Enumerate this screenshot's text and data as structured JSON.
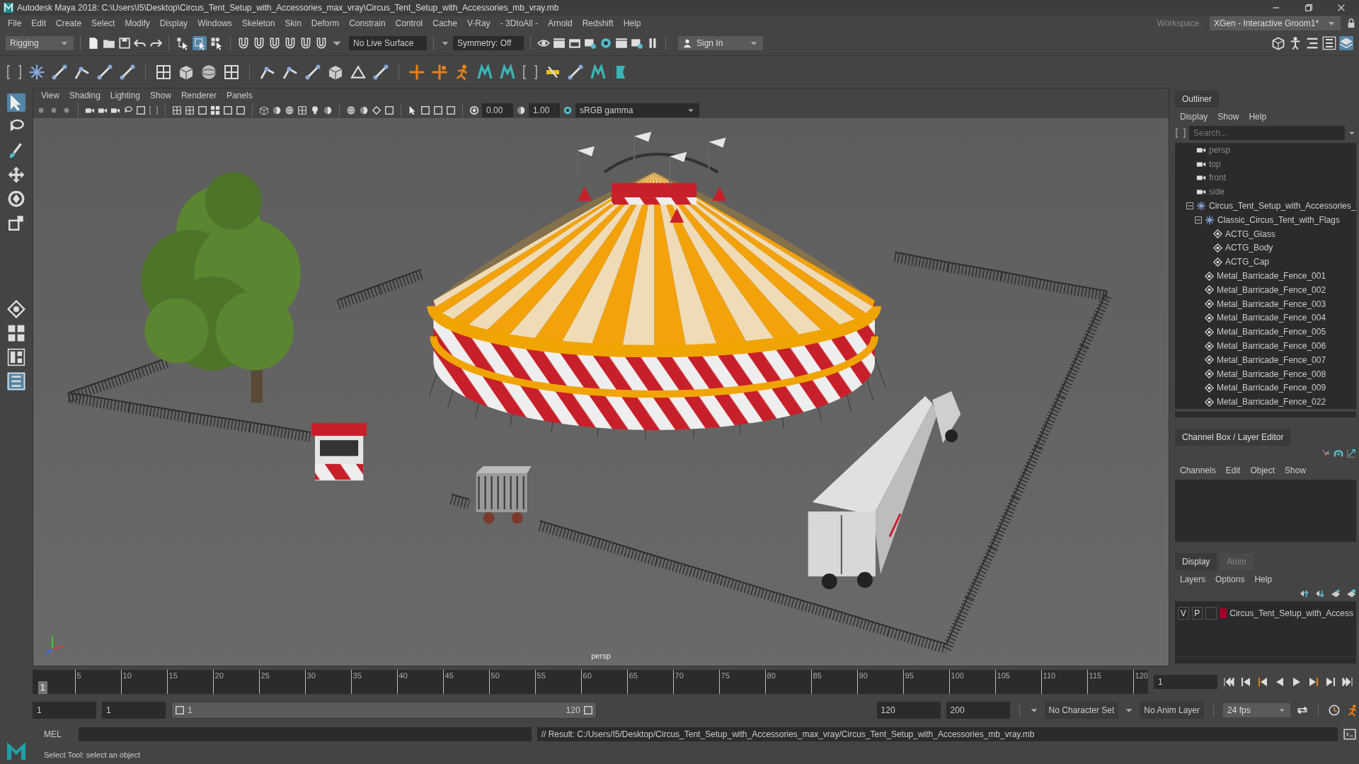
{
  "window": {
    "title": "Autodesk Maya 2018: C:\\Users\\I5\\Desktop\\Circus_Tent_Setup_with_Accessories_max_vray\\Circus_Tent_Setup_with_Accessories_mb_vray.mb"
  },
  "menu_bar": [
    "File",
    "Edit",
    "Create",
    "Select",
    "Modify",
    "Display",
    "Windows",
    "Skeleton",
    "Skin",
    "Deform",
    "Constrain",
    "Control",
    "Cache",
    "V-Ray",
    "- 3DtoAll -",
    "Arnold",
    "Redshift",
    "Help"
  ],
  "workspace": {
    "label": "Workspace :",
    "value": "XGen - Interactive Groom1*"
  },
  "status_line": {
    "mode": "Rigging",
    "selection_modes": [
      {
        "selected": false
      },
      {
        "selected": true
      },
      {
        "selected": false
      }
    ],
    "live_surface": "No Live Surface",
    "symmetry": "Symmetry: Off",
    "sign_in": "Sign In",
    "panel_toggles": [
      {
        "selected": false
      },
      {
        "selected": false
      },
      {
        "selected": false
      },
      {
        "selected": false
      },
      {
        "selected": true
      }
    ]
  },
  "toolbox": {
    "tools": [
      {
        "selected": true
      },
      {
        "selected": false
      },
      {
        "selected": false
      },
      {
        "selected": false
      },
      {
        "selected": false
      },
      {
        "selected": false
      }
    ],
    "layouts": [
      {
        "selected": false
      },
      {
        "selected": false
      },
      {
        "selected": false
      },
      {
        "selected": true
      }
    ]
  },
  "viewport": {
    "menus": [
      "View",
      "Shading",
      "Lighting",
      "Show",
      "Renderer",
      "Panels"
    ],
    "exposure": "0.00",
    "gamma": "1.00",
    "color_space": "sRGB gamma",
    "camera_label": "persp"
  },
  "outliner": {
    "title": "Outliner",
    "menus": [
      "Display",
      "Show",
      "Help"
    ],
    "search": {
      "placeholder": "Search..."
    },
    "items": [
      {
        "label": "persp",
        "kind": "camera"
      },
      {
        "label": "top",
        "kind": "camera"
      },
      {
        "label": "front",
        "kind": "camera"
      },
      {
        "label": "side",
        "kind": "camera"
      },
      {
        "label": "Circus_Tent_Setup_with_Accessories_",
        "kind": "group",
        "expanded": true,
        "children": [
          {
            "label": "Classic_Circus_Tent_with_Flags",
            "kind": "group",
            "expanded": true,
            "children": [
              {
                "label": "ACTG_Glass",
                "kind": "mesh"
              },
              {
                "label": "ACTG_Body",
                "kind": "mesh"
              },
              {
                "label": "ACTG_Cap",
                "kind": "mesh"
              }
            ]
          },
          {
            "label": "Metal_Barricade_Fence_001",
            "kind": "mesh"
          },
          {
            "label": "Metal_Barricade_Fence_002",
            "kind": "mesh"
          },
          {
            "label": "Metal_Barricade_Fence_003",
            "kind": "mesh"
          },
          {
            "label": "Metal_Barricade_Fence_004",
            "kind": "mesh"
          },
          {
            "label": "Metal_Barricade_Fence_005",
            "kind": "mesh"
          },
          {
            "label": "Metal_Barricade_Fence_006",
            "kind": "mesh"
          },
          {
            "label": "Metal_Barricade_Fence_007",
            "kind": "mesh"
          },
          {
            "label": "Metal_Barricade_Fence_008",
            "kind": "mesh"
          },
          {
            "label": "Metal_Barricade_Fence_009",
            "kind": "mesh"
          },
          {
            "label": "Metal_Barricade_Fence_022",
            "kind": "mesh"
          }
        ]
      }
    ]
  },
  "channel_box": {
    "title": "Channel Box / Layer Editor",
    "menus": [
      "Channels",
      "Edit",
      "Object",
      "Show"
    ]
  },
  "layer_editor": {
    "tabs": [
      {
        "label": "Display",
        "selected": true
      },
      {
        "label": "Anim",
        "selected": false
      }
    ],
    "menus": [
      "Layers",
      "Options",
      "Help"
    ],
    "layers": [
      {
        "visibility": "V",
        "playback": "P",
        "color": "#a0002a",
        "name": "Circus_Tent_Setup_with_Access"
      }
    ]
  },
  "time_slider": {
    "current_marker": "1",
    "level": 0,
    "ticks": [
      "5",
      "10",
      "15",
      "20",
      "25",
      "30",
      "35",
      "40",
      "45",
      "50",
      "55",
      "60",
      "65",
      "70",
      "75",
      "80",
      "85",
      "90",
      "95",
      "100",
      "105",
      "110",
      "115",
      "120"
    ],
    "current_frame": "1"
  },
  "range_slider": {
    "start": "1",
    "playback_start": "1",
    "handle_start": "1",
    "handle_end": "120",
    "level": 1,
    "playback_end": "120",
    "end": "200",
    "character_set": "No Character Set",
    "anim_layer": "No Anim Layer",
    "fps": "24 fps"
  },
  "command_line": {
    "language": "MEL",
    "result": "// Result: C:/Users/I5/Desktop/Circus_Tent_Setup_with_Accessories_max_vray/Circus_Tent_Setup_with_Accessories_mb_vray.mb"
  },
  "help_line": "Select Tool: select an object"
}
